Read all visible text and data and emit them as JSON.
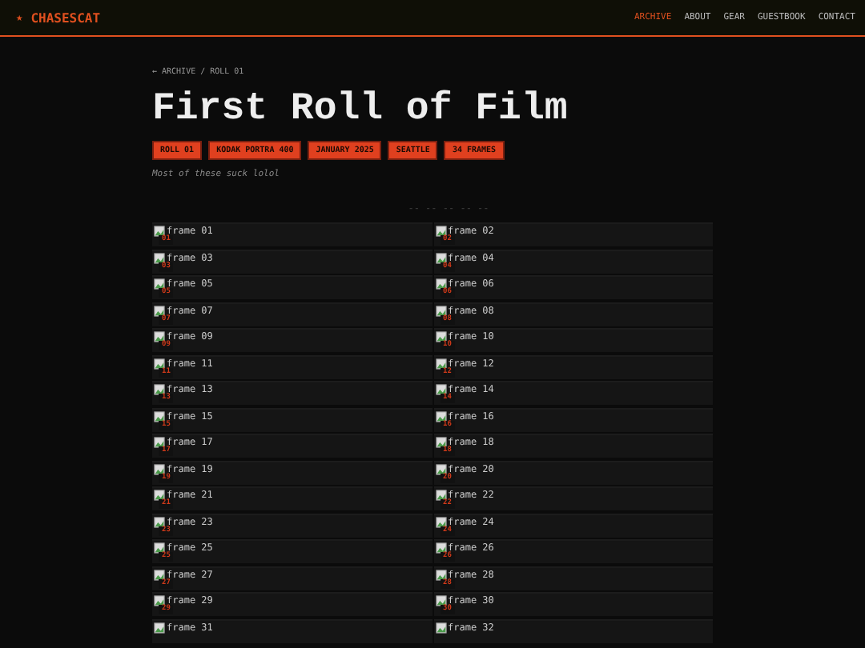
{
  "site": {
    "logo_icon": "★",
    "name": "CHASESCAT"
  },
  "nav": [
    {
      "label": "ARCHIVE",
      "selected": true
    },
    {
      "label": "ABOUT",
      "selected": false
    },
    {
      "label": "GEAR",
      "selected": false
    },
    {
      "label": "GUESTBOOK",
      "selected": false
    },
    {
      "label": "CONTACT",
      "selected": false
    }
  ],
  "breadcrumb": "← ARCHIVE / ROLL 01",
  "title": "First Roll of Film",
  "tags": [
    "ROLL 01",
    "KODAK PORTRA 400",
    "JANUARY 2025",
    "SEATTLE",
    "34 FRAMES"
  ],
  "subtitle": "Most of these suck lolol",
  "divider": "-- -- -- -- --",
  "frames": [
    {
      "alt": "frame 01",
      "number": "01"
    },
    {
      "alt": "frame 02",
      "number": "02"
    },
    {
      "alt": "frame 03",
      "number": "03"
    },
    {
      "alt": "frame 04",
      "number": "04"
    },
    {
      "alt": "frame 05",
      "number": "05"
    },
    {
      "alt": "frame 06",
      "number": "06"
    },
    {
      "alt": "frame 07",
      "number": "07"
    },
    {
      "alt": "frame 08",
      "number": "08"
    },
    {
      "alt": "frame 09",
      "number": "09"
    },
    {
      "alt": "frame 10",
      "number": "10"
    },
    {
      "alt": "frame 11",
      "number": "11"
    },
    {
      "alt": "frame 12",
      "number": "12"
    },
    {
      "alt": "frame 13",
      "number": "13"
    },
    {
      "alt": "frame 14",
      "number": "14"
    },
    {
      "alt": "frame 15",
      "number": "15"
    },
    {
      "alt": "frame 16",
      "number": "16"
    },
    {
      "alt": "frame 17",
      "number": "17"
    },
    {
      "alt": "frame 18",
      "number": "18"
    },
    {
      "alt": "frame 19",
      "number": "19"
    },
    {
      "alt": "frame 20",
      "number": "20"
    },
    {
      "alt": "frame 21",
      "number": "21"
    },
    {
      "alt": "frame 22",
      "number": "22"
    },
    {
      "alt": "frame 23",
      "number": "23"
    },
    {
      "alt": "frame 24",
      "number": "24"
    },
    {
      "alt": "frame 25",
      "number": "25"
    },
    {
      "alt": "frame 26",
      "number": "26"
    },
    {
      "alt": "frame 27",
      "number": "27"
    },
    {
      "alt": "frame 28",
      "number": "28"
    },
    {
      "alt": "frame 29",
      "number": "29"
    },
    {
      "alt": "frame 30",
      "number": "30"
    },
    {
      "alt": "frame 31"
    },
    {
      "alt": "frame 32"
    }
  ]
}
